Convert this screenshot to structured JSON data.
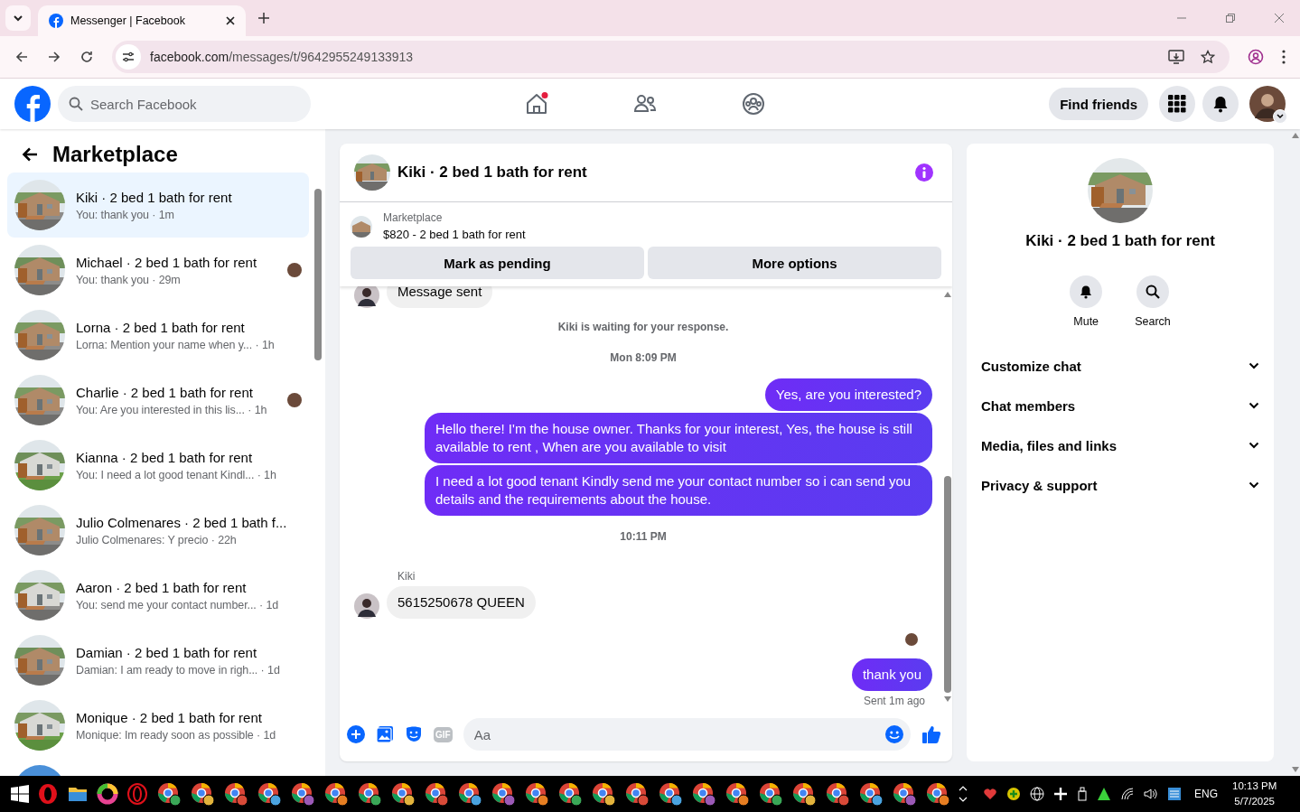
{
  "browser": {
    "tab_title": "Messenger | Facebook",
    "url_host": "facebook.com",
    "url_path": "/messages/t/9642955249133913"
  },
  "header": {
    "search_placeholder": "Search Facebook",
    "find_friends": "Find friends"
  },
  "sidebar": {
    "title": "Marketplace",
    "items": [
      {
        "name": "Kiki · 2 bed 1 bath for rent",
        "preview": "You: thank you · 1m",
        "selected": true,
        "seen": false
      },
      {
        "name": "Michael · 2 bed 1 bath for rent",
        "preview": "You: thank you · 29m",
        "selected": false,
        "seen": true
      },
      {
        "name": "Lorna · 2 bed 1 bath for rent",
        "preview": "Lorna: Mention your name when y...  · 1h",
        "selected": false,
        "seen": false
      },
      {
        "name": "Charlie · 2 bed 1 bath for rent",
        "preview": "You: Are you interested in this lis... · 1h",
        "selected": false,
        "seen": true
      },
      {
        "name": "Kianna · 2 bed 1 bath for rent",
        "preview": "You: I need a lot good tenant Kindl...  · 1h",
        "selected": false,
        "seen": false
      },
      {
        "name": "Julio Colmenares · 2 bed 1 bath f...",
        "preview": "Julio Colmenares: Y precio · 22h",
        "selected": false,
        "seen": false
      },
      {
        "name": "Aaron · 2 bed 1 bath for rent",
        "preview": "You: send me your contact number... · 1d",
        "selected": false,
        "seen": false
      },
      {
        "name": "Damian · 2 bed 1 bath for rent",
        "preview": "Damian: I am ready to move in righ... · 1d",
        "selected": false,
        "seen": false
      },
      {
        "name": "Monique · 2 bed 1 bath for rent",
        "preview": "Monique: Im ready soon as possible · 1d",
        "selected": false,
        "seen": false
      }
    ]
  },
  "chat": {
    "title": "Kiki · 2 bed 1 bath for rent",
    "listing": {
      "source": "Marketplace",
      "title": "$820 - 2 bed 1 bath for rent"
    },
    "actions": [
      "Mark as pending",
      "More options"
    ],
    "messages": [
      {
        "kind": "incoming",
        "text": "Message sent"
      },
      {
        "kind": "system",
        "text": "Kiki is waiting for your response."
      },
      {
        "kind": "time",
        "text": "Mon 8:09 PM"
      },
      {
        "kind": "outgoing",
        "text": "Yes, are you interested?"
      },
      {
        "kind": "outgoing",
        "text": "Hello there! I'm the house owner. Thanks for your interest, Yes, the house is still available to rent , When are you available to visit"
      },
      {
        "kind": "outgoing",
        "text": "I need a lot good tenant Kindly send me your contact number so i can send you details and the requirements about the house."
      },
      {
        "kind": "time",
        "text": "10:11 PM"
      },
      {
        "kind": "sender",
        "text": "Kiki"
      },
      {
        "kind": "incoming",
        "text": "5615250678 QUEEN"
      },
      {
        "kind": "seen"
      },
      {
        "kind": "outgoing",
        "text": "thank you"
      },
      {
        "kind": "status",
        "text": "Sent 1m ago"
      }
    ],
    "composer": {
      "gif": "GIF",
      "placeholder": "Aa"
    }
  },
  "info": {
    "title": "Kiki · 2 bed 1 bath for rent",
    "actions": [
      "Mute",
      "Search"
    ],
    "sections": [
      "Customize chat",
      "Chat members",
      "Media, files and links",
      "Privacy & support"
    ]
  },
  "taskbar": {
    "language": "ENG",
    "time": "10:13 PM",
    "date": "5/7/2025"
  }
}
